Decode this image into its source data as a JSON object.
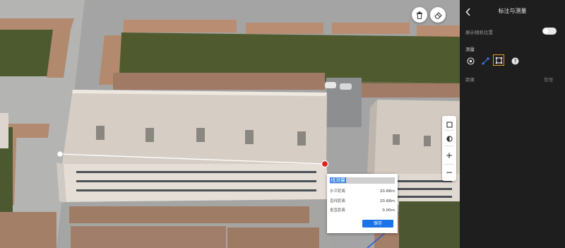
{
  "map": {
    "toolbar": {
      "delete_icon": "trash-icon",
      "eraser_icon": "eraser-icon"
    },
    "zoom_tools": {
      "layer_icon": "layer-square-icon",
      "compass_icon": "compass-icon",
      "zoom_in": "+",
      "zoom_out": "−"
    },
    "measurement": {
      "name": "线测量",
      "rows": [
        {
          "label": "水平距离",
          "value": "20.68m"
        },
        {
          "label": "直线距离",
          "value": "20.68m"
        },
        {
          "label": "垂直距离",
          "value": "0.00m"
        }
      ],
      "save_label": "保存"
    }
  },
  "panel": {
    "back_icon": "chevron-left-icon",
    "title": "标注与测量",
    "show_label": "展示相机位置",
    "show_toggle_on": false,
    "measure_label": "测量",
    "tools": [
      {
        "name": "point",
        "icon": "point-icon"
      },
      {
        "name": "line",
        "icon": "line-icon"
      },
      {
        "name": "area",
        "icon": "area-icon",
        "active": true
      },
      {
        "name": "help",
        "icon": "help-icon"
      }
    ],
    "distance_label": "距离",
    "manage_label": "管理"
  },
  "colors": {
    "accent": "#1a73e8",
    "active_tool_border": "#e39b18",
    "measure_point": "#e02020"
  }
}
